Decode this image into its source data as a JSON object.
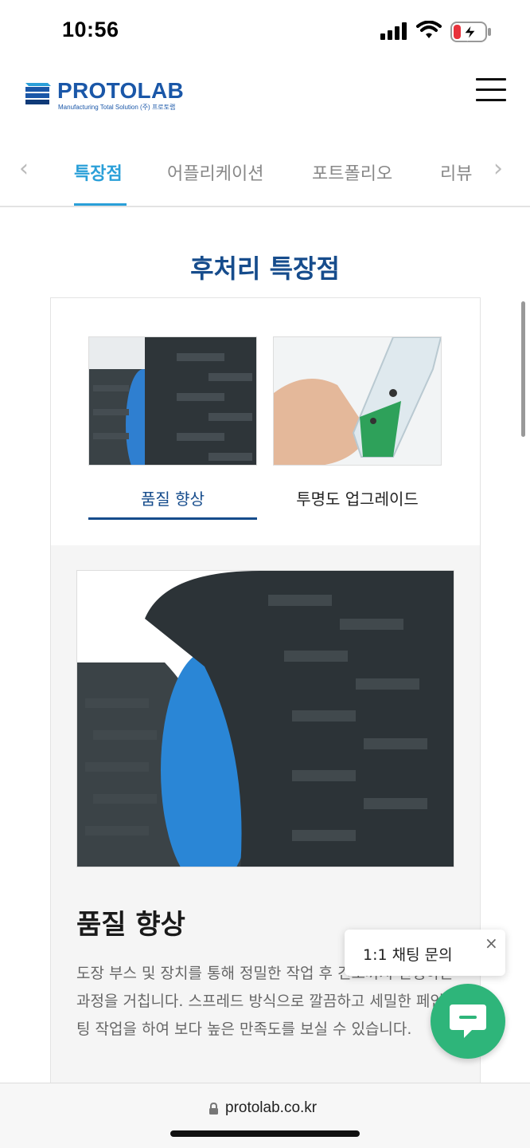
{
  "status_bar": {
    "time": "10:56"
  },
  "header": {
    "logo_name": "PROTOLAB",
    "logo_sub": "Manufacturing Total Solution (주) 프로토랩"
  },
  "tabs": [
    {
      "label": "특장점",
      "active": true
    },
    {
      "label": "어플리케이션",
      "active": false
    },
    {
      "label": "포트폴리오",
      "active": false
    },
    {
      "label": "리뷰",
      "active": false
    }
  ],
  "section": {
    "title": "후처리 특장점",
    "options": [
      {
        "label": "품질 향상",
        "selected": true
      },
      {
        "label": "투명도 업그레이드",
        "selected": false
      }
    ],
    "detail_title": "품질 향상",
    "detail_desc": "도장 부스 및 장치를 통해 정밀한 작업 후 건조까지 진행하는 과정을 거칩니다. 스프레드 방식으로 깔끔하고 세밀한 페인팅 작업을 하여 보다 높은 만족도를 보실 수 있습니다."
  },
  "chat": {
    "tooltip": "1:1 채팅 문의",
    "close": "×"
  },
  "browser": {
    "url": "protolab.co.kr"
  },
  "colors": {
    "brand": "#164c8c",
    "accent": "#2a9fd8",
    "chat": "#2eb57a"
  },
  "icons": [
    "signal-icon",
    "wifi-icon",
    "battery-charging-icon",
    "menu-icon",
    "chevron-left-icon",
    "chevron-right-icon",
    "chat-bubble-icon",
    "close-icon",
    "lock-icon"
  ]
}
